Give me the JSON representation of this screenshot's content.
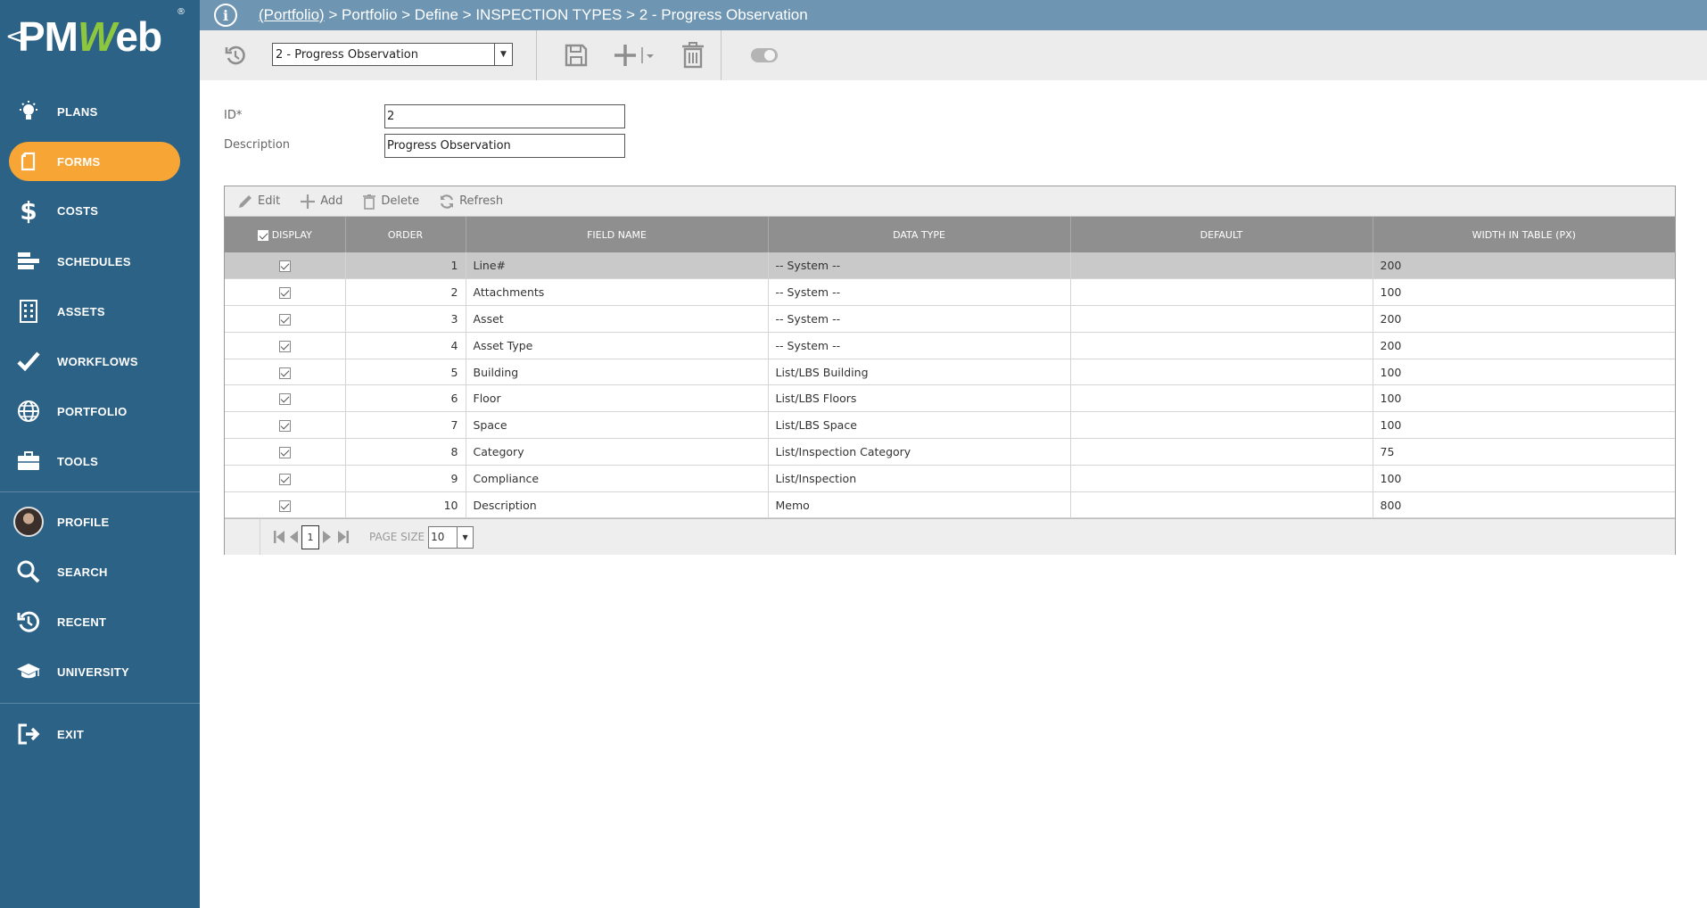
{
  "logo": {
    "back": "<",
    "pm": "PM",
    "w": "W",
    "eb": "eb",
    "reg": "®"
  },
  "sidebar": {
    "items": [
      {
        "label": "PLANS",
        "icon": "lightbulb-icon"
      },
      {
        "label": "FORMS",
        "icon": "document-icon",
        "active": true
      },
      {
        "label": "COSTS",
        "icon": "dollar-icon"
      },
      {
        "label": "SCHEDULES",
        "icon": "bars-icon"
      },
      {
        "label": "ASSETS",
        "icon": "building-icon"
      },
      {
        "label": "WORKFLOWS",
        "icon": "checkmark-icon"
      },
      {
        "label": "PORTFOLIO",
        "icon": "globe-icon"
      },
      {
        "label": "TOOLS",
        "icon": "briefcase-icon"
      }
    ],
    "secondary": [
      {
        "label": "PROFILE",
        "icon": "avatar"
      },
      {
        "label": "SEARCH",
        "icon": "search-icon"
      },
      {
        "label": "RECENT",
        "icon": "history-icon"
      },
      {
        "label": "UNIVERSITY",
        "icon": "graduation-cap-icon"
      }
    ],
    "exit": {
      "label": "EXIT",
      "icon": "exit-icon"
    }
  },
  "header": {
    "crumb_link": "(Portfolio)",
    "crumb_rest": " > Portfolio > Define > INSPECTION TYPES > 2 - Progress Observation"
  },
  "toolbar": {
    "record_select_value": "2 - Progress Observation"
  },
  "form": {
    "id_label": "ID*",
    "id_value": "2",
    "description_label": "Description",
    "description_value": "Progress Observation"
  },
  "grid": {
    "toolbar": {
      "edit": "Edit",
      "add": "Add",
      "delete": "Delete",
      "refresh": "Refresh"
    },
    "columns": [
      "DISPLAY",
      "ORDER",
      "FIELD NAME",
      "DATA TYPE",
      "DEFAULT",
      "WIDTH IN TABLE (PX)"
    ],
    "rows": [
      {
        "display": true,
        "order": "1",
        "field_name": "Line#",
        "data_type": "-- System --",
        "default": "",
        "width": "200",
        "selected": true
      },
      {
        "display": true,
        "order": "2",
        "field_name": "Attachments",
        "data_type": "-- System --",
        "default": "",
        "width": "100"
      },
      {
        "display": true,
        "order": "3",
        "field_name": "Asset",
        "data_type": "-- System --",
        "default": "",
        "width": "200"
      },
      {
        "display": true,
        "order": "4",
        "field_name": "Asset Type",
        "data_type": "-- System --",
        "default": "",
        "width": "200"
      },
      {
        "display": true,
        "order": "5",
        "field_name": "Building",
        "data_type": "List/LBS Building",
        "default": "",
        "width": "100"
      },
      {
        "display": true,
        "order": "6",
        "field_name": "Floor",
        "data_type": "List/LBS Floors",
        "default": "",
        "width": "100"
      },
      {
        "display": true,
        "order": "7",
        "field_name": "Space",
        "data_type": "List/LBS Space",
        "default": "",
        "width": "100"
      },
      {
        "display": true,
        "order": "8",
        "field_name": "Category",
        "data_type": "List/Inspection Category",
        "default": "",
        "width": "75"
      },
      {
        "display": true,
        "order": "9",
        "field_name": "Compliance",
        "data_type": "List/Inspection",
        "default": "",
        "width": "100"
      },
      {
        "display": true,
        "order": "10",
        "field_name": "Description",
        "data_type": "Memo",
        "default": "",
        "width": "800"
      }
    ],
    "pager": {
      "current_page": "1",
      "page_size_label": "PAGE SIZE",
      "page_size": "10"
    }
  },
  "colors": {
    "sidebar": "#2d6287",
    "active": "#f7a535",
    "header": "#6e95b2",
    "grid_header": "#8f8f8f"
  }
}
